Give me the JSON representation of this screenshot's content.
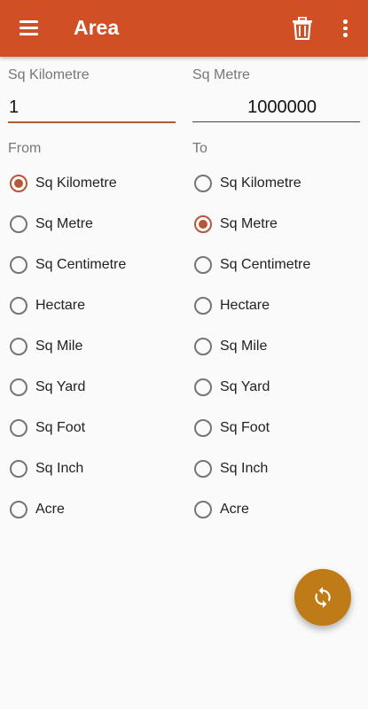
{
  "app": {
    "title": "Area",
    "bar_color": "#d14f25",
    "accent_color": "#b5573a",
    "fab_color": "#bf7b18",
    "icons": {
      "menu": "menu-icon",
      "delete": "trash-icon",
      "more": "more-vert-icon",
      "fab": "swap-refresh-icon"
    }
  },
  "input_from": {
    "label": "Sq Kilometre",
    "value": "1"
  },
  "input_to": {
    "label": "Sq Metre",
    "value": "1000000"
  },
  "from_group": {
    "heading": "From",
    "selected": 0,
    "options": [
      {
        "label": "Sq Kilometre"
      },
      {
        "label": "Sq Metre"
      },
      {
        "label": "Sq Centimetre"
      },
      {
        "label": "Hectare"
      },
      {
        "label": "Sq Mile"
      },
      {
        "label": "Sq Yard"
      },
      {
        "label": "Sq Foot"
      },
      {
        "label": "Sq Inch"
      },
      {
        "label": "Acre"
      }
    ]
  },
  "to_group": {
    "heading": "To",
    "selected": 1,
    "options": [
      {
        "label": "Sq Kilometre"
      },
      {
        "label": "Sq Metre"
      },
      {
        "label": "Sq Centimetre"
      },
      {
        "label": "Hectare"
      },
      {
        "label": "Sq Mile"
      },
      {
        "label": "Sq Yard"
      },
      {
        "label": "Sq Foot"
      },
      {
        "label": "Sq Inch"
      },
      {
        "label": "Acre"
      }
    ]
  }
}
